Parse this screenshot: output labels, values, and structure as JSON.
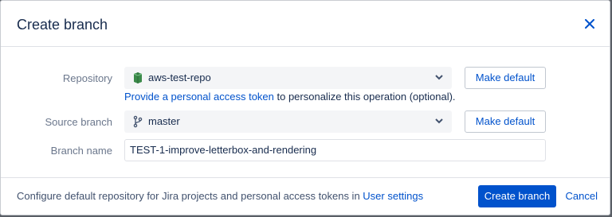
{
  "dialog": {
    "title": "Create branch",
    "close_icon": "close-icon"
  },
  "form": {
    "repository": {
      "label": "Repository",
      "value": "aws-test-repo",
      "icon": "repository-icon",
      "make_default": "Make default"
    },
    "hint": {
      "link_text": "Provide a personal access token",
      "rest_text": " to personalize this operation (optional)."
    },
    "source_branch": {
      "label": "Source branch",
      "value": "master",
      "icon": "branch-icon",
      "make_default": "Make default"
    },
    "branch_name": {
      "label": "Branch name",
      "value": "TEST-1-improve-letterbox-and-rendering"
    }
  },
  "footer": {
    "text": "Configure default repository for Jira projects and personal access tokens in ",
    "link_text": "User settings",
    "primary_button": "Create branch",
    "cancel_button": "Cancel"
  },
  "colors": {
    "accent": "#0052cc",
    "select_bg": "#f4f5f7",
    "label_text": "#6b778c"
  }
}
